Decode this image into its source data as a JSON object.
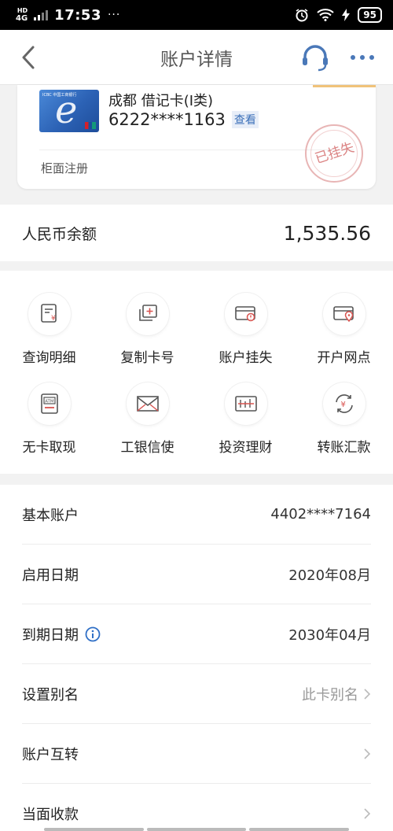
{
  "status_bar": {
    "network": "4G",
    "network_sub": "HD",
    "time": "17:53",
    "dots": "···",
    "battery": "95"
  },
  "nav": {
    "title": "账户详情"
  },
  "card": {
    "name": "成都 借记卡(Ⅰ类)",
    "number": "6222****1163",
    "view_label": "查看",
    "note": "柜面注册",
    "stamp": "已挂失",
    "image_text": "ICBC 中国工商银行"
  },
  "balance": {
    "label": "人民币余额",
    "value": "1,535.56"
  },
  "functions": [
    {
      "label": "查询明细",
      "icon": "statement-icon"
    },
    {
      "label": "复制卡号",
      "icon": "copy-icon"
    },
    {
      "label": "账户挂失",
      "icon": "card-lost-icon"
    },
    {
      "label": "开户网点",
      "icon": "branch-location-icon"
    },
    {
      "label": "无卡取现",
      "icon": "atm-icon"
    },
    {
      "label": "工银信使",
      "icon": "envelope-icon"
    },
    {
      "label": "投资理财",
      "icon": "investment-icon"
    },
    {
      "label": "转账汇款",
      "icon": "transfer-icon"
    }
  ],
  "rows": [
    {
      "label": "基本账户",
      "value": "4402****7164"
    },
    {
      "label": "启用日期",
      "value": "2020年08月"
    },
    {
      "label": "到期日期",
      "value": "2030年04月"
    },
    {
      "label": "设置别名",
      "value": "此卡别名"
    },
    {
      "label": "账户互转",
      "value": ""
    },
    {
      "label": "当面收款",
      "value": ""
    }
  ],
  "colors": {
    "accent_red": "#d9534f",
    "link_blue": "#3a6fb8",
    "info_blue": "#2f6fc6"
  }
}
